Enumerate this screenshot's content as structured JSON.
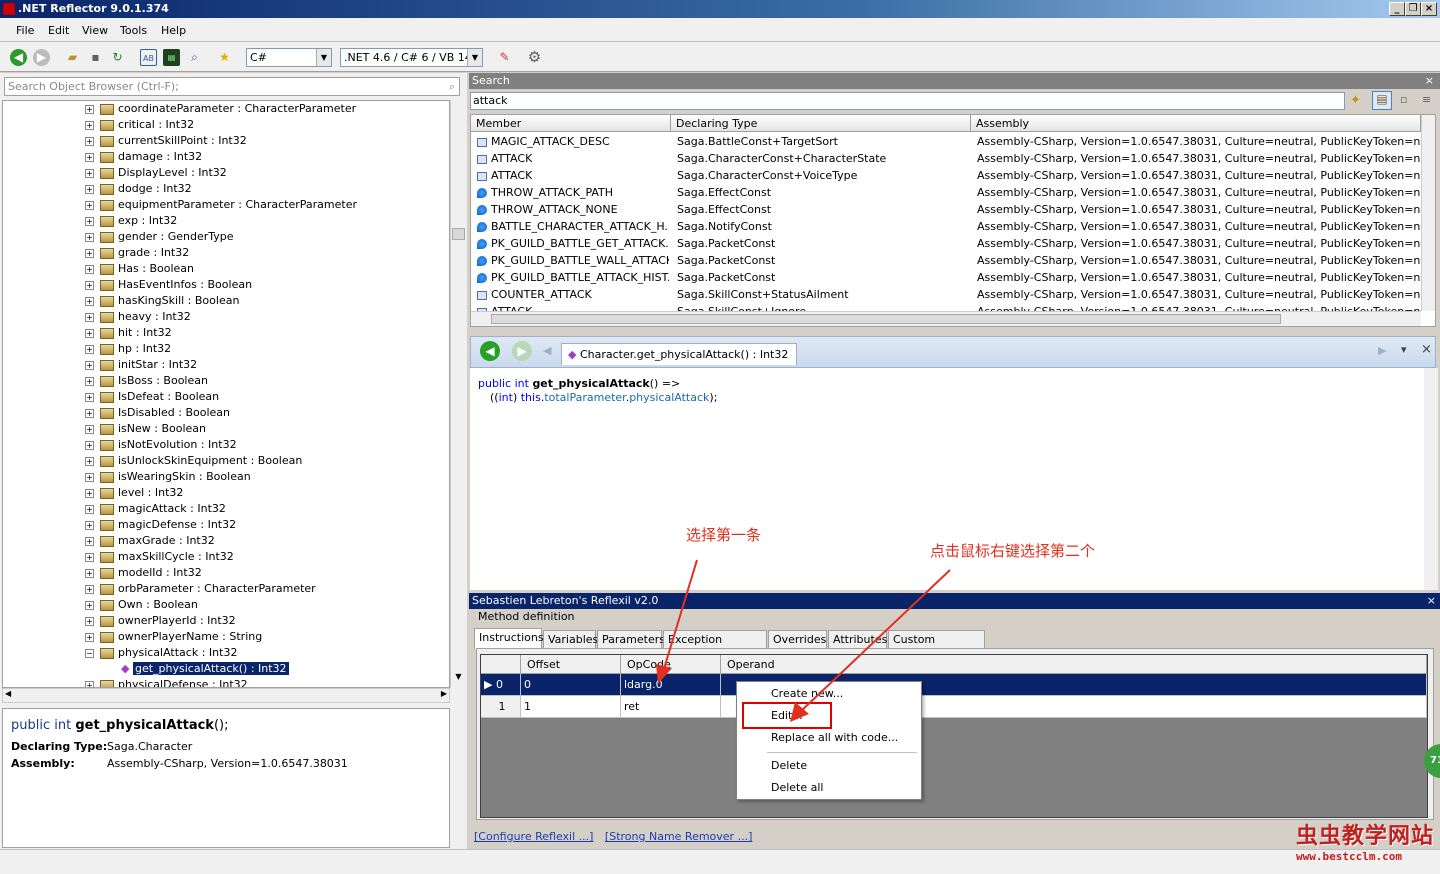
{
  "window": {
    "title": ".NET Reflector 9.0.1.374"
  },
  "menu": [
    "File",
    "Edit",
    "View",
    "Tools",
    "Help"
  ],
  "toolbar": {
    "language": "C#",
    "framework": ".NET 4.6 / C# 6 / VB 14"
  },
  "left": {
    "search_placeholder": "Search Object Browser (Ctrl-F);",
    "tree": [
      "coordinateParameter : CharacterParameter",
      "critical : Int32",
      "currentSkillPoint : Int32",
      "damage : Int32",
      "DisplayLevel : Int32",
      "dodge : Int32",
      "equipmentParameter : CharacterParameter",
      "exp : Int32",
      "gender : GenderType",
      "grade : Int32",
      "Has : Boolean",
      "HasEventInfos : Boolean",
      "hasKingSkill : Boolean",
      "heavy : Int32",
      "hit : Int32",
      "hp : Int32",
      "initStar : Int32",
      "IsBoss : Boolean",
      "IsDefeat : Boolean",
      "IsDisabled : Boolean",
      "isNew : Boolean",
      "isNotEvolution : Int32",
      "isUnlockSkinEquipment : Boolean",
      "isWearingSkin : Boolean",
      "level : Int32",
      "magicAttack : Int32",
      "magicDefense : Int32",
      "maxGrade : Int32",
      "maxSkillCycle : Int32",
      "modelId : Int32",
      "orbParameter : CharacterParameter",
      "Own : Boolean",
      "ownerPlayerId : Int32",
      "ownerPlayerName : String",
      "physicalAttack : Int32"
    ],
    "selected_child": "get_physicalAttack() : Int32",
    "partial_last": "physicalDefense : Int32",
    "info": {
      "sig_kw": "public int",
      "sig_name": "get_physicalAttack",
      "sig_rest": "();",
      "declaring_label": "Declaring Type:",
      "declaring_value": "Saga.Character",
      "assembly_label": "Assembly:",
      "assembly_value": "Assembly-CSharp, Version=1.0.6547.38031"
    }
  },
  "search": {
    "header": "Search",
    "query": "attack",
    "columns": [
      "Member",
      "Declaring Type",
      "Assembly"
    ],
    "rows": [
      {
        "member": "MAGIC_ATTACK_DESC",
        "type": "Saga.BattleConst+TargetSort",
        "asm": "Assembly-CSharp, Version=1.0.6547.38031, Culture=neutral, PublicKeyToken=null",
        "icon": "field"
      },
      {
        "member": "ATTACK",
        "type": "Saga.CharacterConst+CharacterState",
        "asm": "Assembly-CSharp, Version=1.0.6547.38031, Culture=neutral, PublicKeyToken=null",
        "icon": "field"
      },
      {
        "member": "ATTACK",
        "type": "Saga.CharacterConst+VoiceType",
        "asm": "Assembly-CSharp, Version=1.0.6547.38031, Culture=neutral, PublicKeyToken=null",
        "icon": "field"
      },
      {
        "member": "THROW_ATTACK_PATH",
        "type": "Saga.EffectConst",
        "asm": "Assembly-CSharp, Version=1.0.6547.38031, Culture=neutral, PublicKeyToken=null",
        "icon": "const"
      },
      {
        "member": "THROW_ATTACK_NONE",
        "type": "Saga.EffectConst",
        "asm": "Assembly-CSharp, Version=1.0.6547.38031, Culture=neutral, PublicKeyToken=null",
        "icon": "const"
      },
      {
        "member": "BATTLE_CHARACTER_ATTACK_H...",
        "type": "Saga.NotifyConst",
        "asm": "Assembly-CSharp, Version=1.0.6547.38031, Culture=neutral, PublicKeyToken=null",
        "icon": "const"
      },
      {
        "member": "PK_GUILD_BATTLE_GET_ATTACK...",
        "type": "Saga.PacketConst",
        "asm": "Assembly-CSharp, Version=1.0.6547.38031, Culture=neutral, PublicKeyToken=null",
        "icon": "const"
      },
      {
        "member": "PK_GUILD_BATTLE_WALL_ATTACK",
        "type": "Saga.PacketConst",
        "asm": "Assembly-CSharp, Version=1.0.6547.38031, Culture=neutral, PublicKeyToken=null",
        "icon": "const"
      },
      {
        "member": "PK_GUILD_BATTLE_ATTACK_HIST...",
        "type": "Saga.PacketConst",
        "asm": "Assembly-CSharp, Version=1.0.6547.38031, Culture=neutral, PublicKeyToken=null",
        "icon": "const"
      },
      {
        "member": "COUNTER_ATTACK",
        "type": "Saga.SkillConst+StatusAilment",
        "asm": "Assembly-CSharp, Version=1.0.6547.38031, Culture=neutral, PublicKeyToken=null",
        "icon": "field"
      },
      {
        "member": "ATTACK",
        "type": "Saga.SkillConst+Ignore",
        "asm": "Assembly-CSharp, Version=1.0.6547.38031, Culture=neutral, PublicKeyToken=null",
        "icon": "field"
      }
    ]
  },
  "code": {
    "tab_label": "Character.get_physicalAttack() : Int32",
    "line1_kw": "public int",
    "line1_name": "get_physicalAttack",
    "line1_rest": "() =>",
    "line2_a": "((",
    "line2_kw": "int",
    "line2_b": ") ",
    "line2_this": "this",
    "line2_dot": ".",
    "line2_f1": "totalParameter",
    "line2_dot2": ".",
    "line2_f2": "physicalAttack",
    "line2_end": ");"
  },
  "reflexil": {
    "header": "Sebastien Lebreton's Reflexil v2.0",
    "section": "Method definition",
    "tabs": [
      "Instructions",
      "Variables",
      "Parameters",
      "Exception Handlers",
      "Overrides",
      "Attributes",
      "Custom attributes"
    ],
    "grid_columns": [
      "Offset",
      "OpCode",
      "Operand"
    ],
    "rows": [
      {
        "index": "0",
        "offset": "0",
        "opcode": "ldarg.0",
        "operand": ""
      },
      {
        "index": "1",
        "offset": "1",
        "opcode": "ret",
        "operand": ""
      }
    ],
    "context_menu": [
      "Create new...",
      "Edit...",
      "Replace all with code...",
      "Delete",
      "Delete all"
    ],
    "links": [
      "[Configure Reflexil ...]",
      "[Strong Name Remover ...]"
    ]
  },
  "annotations": {
    "first": "选择第一条",
    "second": "点击鼠标右键选择第二个"
  },
  "watermark": {
    "title": "虫虫教学网站",
    "url": "www.bestcclm.com"
  },
  "badge": "71",
  "colors": {
    "selection": "#0a246a",
    "annotation": "#e03020",
    "keyword": "#0000ff"
  }
}
